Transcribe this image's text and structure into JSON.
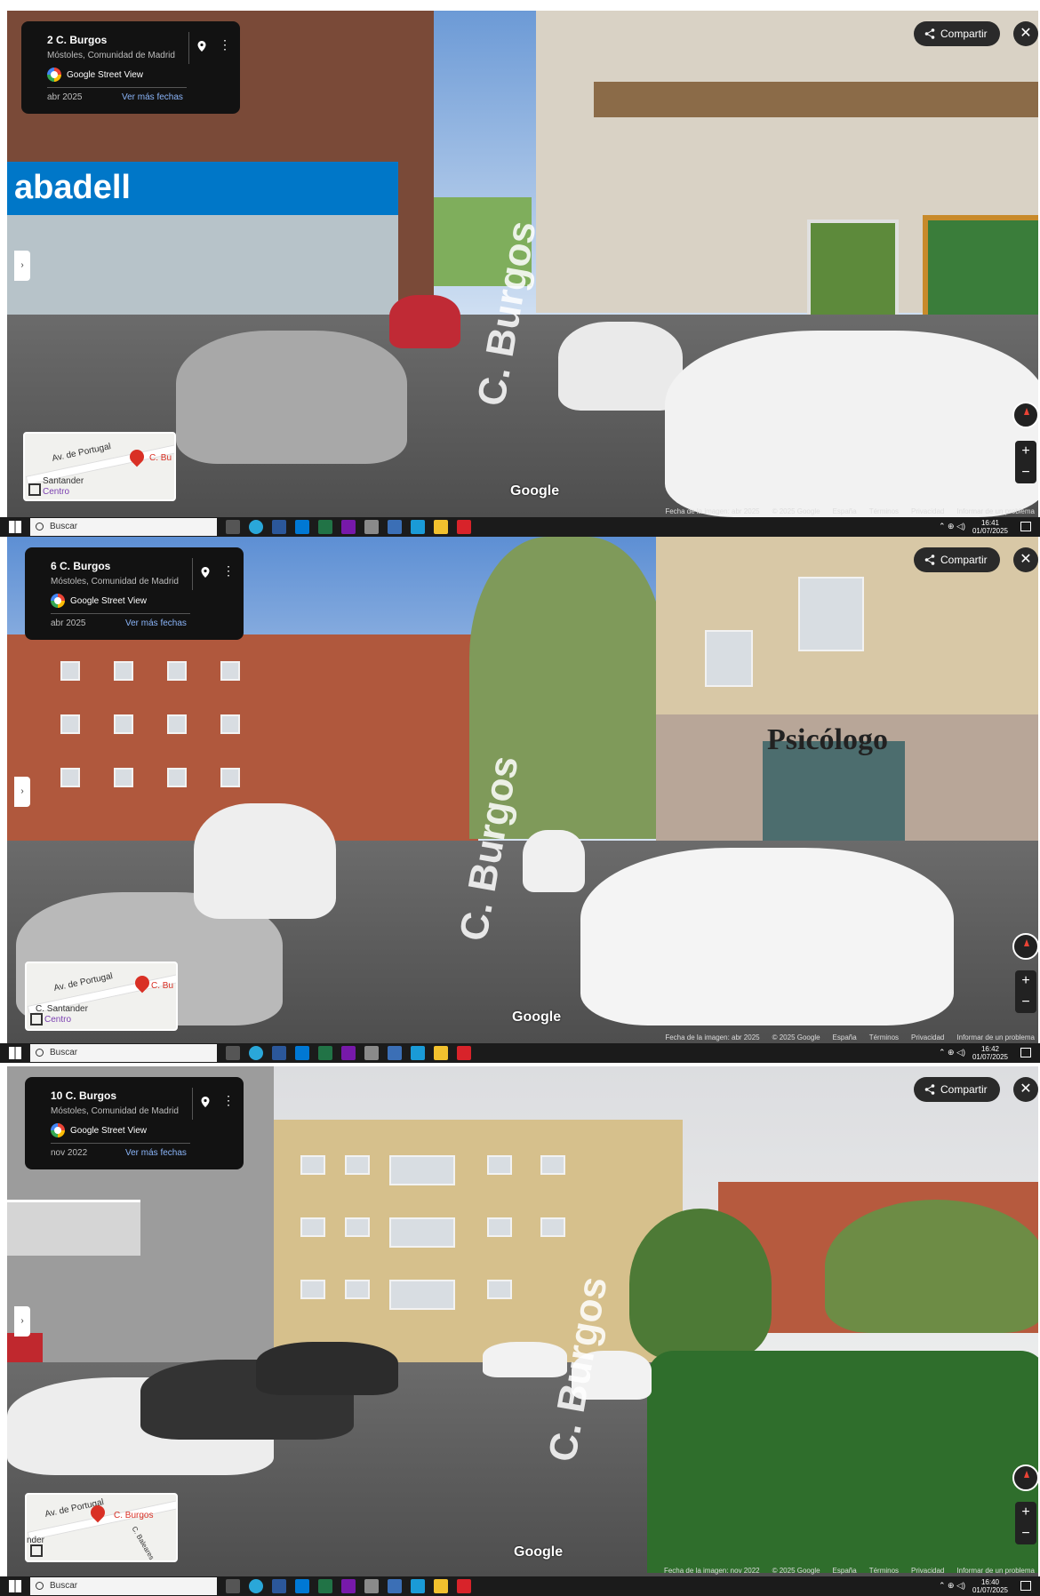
{
  "screens": [
    {
      "address": "2 C. Burgos",
      "locality": "Móstoles, Comunidad de Madrid",
      "source": "Google Street View",
      "date": "abr 2025",
      "more_dates": "Ver más fechas",
      "share": "Compartir",
      "street_label": "C. Burgos",
      "watermark": "Google",
      "footer": {
        "image_date": "Fecha de la imagen: abr 2025",
        "copyright": "© 2025 Google",
        "country": "España",
        "terms": "Términos",
        "privacy": "Privacidad",
        "report": "Informar de un problema"
      },
      "minimap": {
        "road1": "Av. de Portugal",
        "road2": "Santander",
        "road3": "Centro",
        "pin_label": "C. Bu"
      },
      "taskbar": {
        "search": "Buscar",
        "time": "16:41",
        "date": "01/07/2025"
      }
    },
    {
      "address": "6 C. Burgos",
      "locality": "Móstoles, Comunidad de Madrid",
      "source": "Google Street View",
      "date": "abr 2025",
      "more_dates": "Ver más fechas",
      "share": "Compartir",
      "street_label": "C. Burgos",
      "watermark": "Google",
      "sign_text": "Psicólogo",
      "footer": {
        "image_date": "Fecha de la imagen: abr 2025",
        "copyright": "© 2025 Google",
        "country": "España",
        "terms": "Términos",
        "privacy": "Privacidad",
        "report": "Informar de un problema"
      },
      "minimap": {
        "road1": "Av. de Portugal",
        "road2": "C. Santander",
        "road3": "Centro",
        "pin_label": "C. Bu"
      },
      "taskbar": {
        "search": "Buscar",
        "time": "16:42",
        "date": "01/07/2025"
      }
    },
    {
      "address": "10 C. Burgos",
      "locality": "Móstoles, Comunidad de Madrid",
      "source": "Google Street View",
      "date": "nov 2022",
      "more_dates": "Ver más fechas",
      "share": "Compartir",
      "street_label": "C. Burgos",
      "watermark": "Google",
      "footer": {
        "image_date": "Fecha de la imagen: nov 2022",
        "copyright": "© 2025 Google",
        "country": "España",
        "terms": "Términos",
        "privacy": "Privacidad",
        "report": "Informar de un problema"
      },
      "minimap": {
        "road1": "Av. de Portugal",
        "road2": "nder",
        "road3": "C. Baleares",
        "pin_label": "C. Burgos"
      },
      "taskbar": {
        "search": "Buscar",
        "time": "16:40",
        "date": "01/07/2025"
      }
    }
  ],
  "icons": {
    "start": "windows-start-icon",
    "search": "search-icon",
    "share": "share-icon",
    "close": "close-icon",
    "pin": "location-pin-icon",
    "more": "more-vertical-icon",
    "compass": "compass-icon",
    "expand": "expand-icon"
  },
  "colors": {
    "card_bg": "#121212",
    "link": "#8ab4f8",
    "pin": "#d93025",
    "taskbar": "#1b1b1b",
    "sabadell_blue": "#0077c8"
  }
}
